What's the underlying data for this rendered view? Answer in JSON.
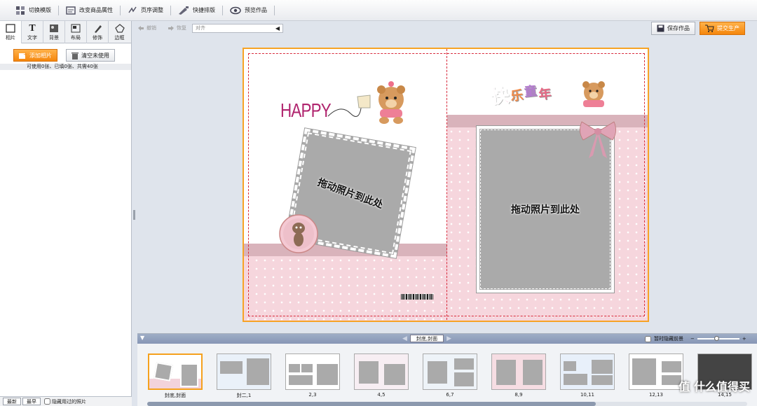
{
  "toolbar": {
    "switch_template": "切换模版",
    "change_props": "改变商品属性",
    "page_order": "页序调整",
    "quick_layout": "快捷排版",
    "preview": "预览作品"
  },
  "left_panel": {
    "tabs": [
      "相片",
      "文字",
      "背景",
      "布局",
      "修饰",
      "边框"
    ],
    "add_photo": "添加相片",
    "clear_unused": "清空未使用",
    "stats": "可使用0张、已填0张、共需40张",
    "sort_newest": "最新",
    "sort_oldest": "最早",
    "hide_used": "隐藏用过的照片"
  },
  "edit_bar": {
    "undo": "撤销",
    "redo": "恢复",
    "align_placeholder": "对齐"
  },
  "actions": {
    "save": "保存作品",
    "submit": "提交生产"
  },
  "canvas": {
    "happy_text": "HAPPY",
    "title_chars": [
      "快",
      "乐",
      "童",
      "年"
    ],
    "left_slot_text": "拖动照片到此处",
    "right_slot_text": "拖动照片到此处"
  },
  "pages_panel": {
    "current_page": "封底,封面",
    "hide_bg_label": "暂时隐藏前景",
    "thumbs": [
      "封底,封面",
      "封二,1",
      "2,3",
      "4,5",
      "6,7",
      "8,9",
      "10,11",
      "12,13",
      "14,15"
    ],
    "watermark": "值 什么值得买"
  },
  "colors": {
    "accent_orange": "#f5860c",
    "pink_bg": "#f6d6dd",
    "band_pink": "#d9b3bb",
    "happy_magenta": "#b0246e"
  }
}
